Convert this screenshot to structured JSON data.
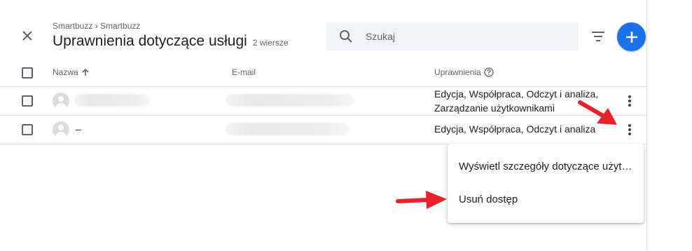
{
  "breadcrumb": "Smartbuzz › Smartbuzz",
  "page_title": "Uprawnienia dotyczące usługi",
  "row_count": "2 wiersze",
  "search": {
    "placeholder": "Szukaj"
  },
  "columns": {
    "name": "Nazwa",
    "email": "E-mail",
    "permissions": "Uprawnienia"
  },
  "rows": [
    {
      "name": "",
      "email": "",
      "permissions": [
        "Edycja, Współpraca, Odczyt i analiza,",
        "Zarządzanie użytkownikami"
      ]
    },
    {
      "name": "–",
      "email": "",
      "permissions": [
        "Edycja, Współpraca, Odczyt i analiza"
      ]
    }
  ],
  "menu": {
    "view_details": "Wyświetl szczegóły dotyczące użytkownika",
    "remove_access": "Usuń dostęp"
  },
  "icons": [
    "close-icon",
    "search-icon",
    "filter-icon",
    "add-icon",
    "arrow-up-icon",
    "help-icon",
    "more-vert-icon",
    "avatar-icon"
  ],
  "colors": {
    "accent": "#1a73e8",
    "annotation_arrow": "#e8222a"
  }
}
